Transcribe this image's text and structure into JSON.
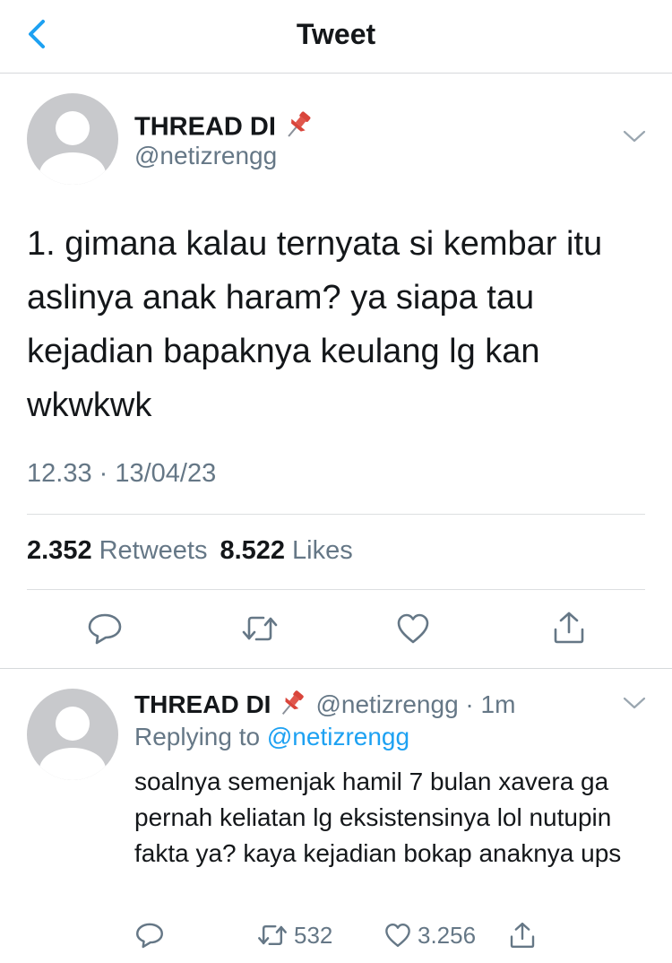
{
  "navbar": {
    "title": "Tweet"
  },
  "tweet": {
    "display_name": "THREAD DI",
    "handle": "@netizrengg",
    "text": "1. gimana kalau ternyata si kembar itu aslinya anak haram? ya siapa tau kejadian bapaknya keulang lg kan wkwkwk",
    "timestamp": "12.33 · 13/04/23",
    "retweets_count": "2.352",
    "retweets_label": "Retweets",
    "likes_count": "8.522",
    "likes_label": "Likes"
  },
  "reply": {
    "display_name": "THREAD DI",
    "handle_time": "@netizrengg · 1m",
    "replying_prefix": "Replying to",
    "replying_handle": "@netizrengg",
    "text": "soalnya semenjak hamil 7 bulan xavera ga pernah keliatan lg eksistensinya lol nutupin fakta ya? kaya kejadian bokap anaknya ups",
    "retweets": "532",
    "likes": "3.256"
  },
  "colors": {
    "accent": "#1da1f2",
    "secondary_text": "#657786",
    "primary_text": "#14171a",
    "icon": "#657786",
    "pin": "#d9453b"
  },
  "icons": {
    "back": "chevron-left-icon",
    "menu": "chevron-down-icon",
    "pin": "pushpin-icon",
    "reply": "speech-bubble-icon",
    "retweet": "retweet-icon",
    "like": "heart-icon",
    "share": "share-icon"
  }
}
